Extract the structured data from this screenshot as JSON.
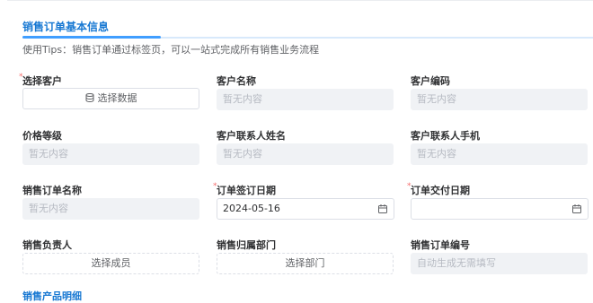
{
  "section": {
    "title": "销售订单基本信息",
    "tips": "使用Tips：销售订单通过标签页，可以一站式完成所有销售业务流程"
  },
  "form": {
    "customer": {
      "label": "选择客户",
      "button": "选择数据"
    },
    "customer_name": {
      "label": "客户名称",
      "placeholder": "暂无内容"
    },
    "customer_code": {
      "label": "客户编码",
      "placeholder": "暂无内容"
    },
    "price_level": {
      "label": "价格等级",
      "placeholder": "暂无内容"
    },
    "contact_name": {
      "label": "客户联系人姓名",
      "placeholder": "暂无内容"
    },
    "contact_phone": {
      "label": "客户联系人手机",
      "placeholder": "暂无内容"
    },
    "order_name": {
      "label": "销售订单名称",
      "placeholder": "暂无内容"
    },
    "sign_date": {
      "label": "订单签订日期",
      "value": "2024-05-16"
    },
    "delivery_date": {
      "label": "订单交付日期",
      "value": ""
    },
    "owner": {
      "label": "销售负责人",
      "button": "选择成员"
    },
    "department": {
      "label": "销售归属部门",
      "button": "选择部门"
    },
    "order_no": {
      "label": "销售订单编号",
      "placeholder": "自动生成无需填写"
    }
  },
  "next_section_partial": "销售产品明细",
  "colors": {
    "accent": "#409eff",
    "required": "#f56c6c",
    "disabled_bg": "#f0f2f5"
  }
}
